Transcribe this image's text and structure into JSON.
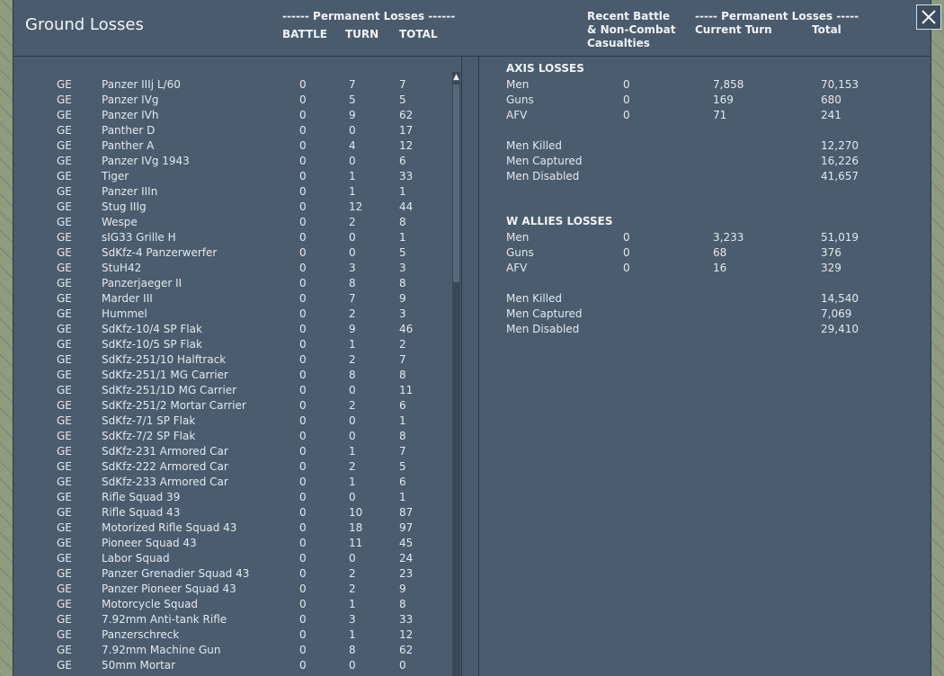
{
  "window": {
    "title": "Ground Losses",
    "left_header": {
      "group": "------ Permanent Losses ------",
      "battle": "BATTLE",
      "turn": "TURN",
      "total": "TOTAL"
    },
    "right_header": {
      "recent_line1": "Recent Battle",
      "recent_line2": "& Non-Combat",
      "recent_line3": "Casualties",
      "group": "----- Permanent Losses -----",
      "current_turn": "Current Turn",
      "total": "Total"
    }
  },
  "units": [
    {
      "nat": "GE",
      "name": "Panzer IIIj L/60",
      "battle": "0",
      "turn": "7",
      "total": "7"
    },
    {
      "nat": "GE",
      "name": "Panzer IVg",
      "battle": "0",
      "turn": "5",
      "total": "5"
    },
    {
      "nat": "GE",
      "name": "Panzer IVh",
      "battle": "0",
      "turn": "9",
      "total": "62"
    },
    {
      "nat": "GE",
      "name": "Panther D",
      "battle": "0",
      "turn": "0",
      "total": "17"
    },
    {
      "nat": "GE",
      "name": "Panther A",
      "battle": "0",
      "turn": "4",
      "total": "12"
    },
    {
      "nat": "GE",
      "name": "Panzer IVg 1943",
      "battle": "0",
      "turn": "0",
      "total": "6"
    },
    {
      "nat": "GE",
      "name": "Tiger",
      "battle": "0",
      "turn": "1",
      "total": "33"
    },
    {
      "nat": "GE",
      "name": "Panzer IIIn",
      "battle": "0",
      "turn": "1",
      "total": "1"
    },
    {
      "nat": "GE",
      "name": "Stug IIIg",
      "battle": "0",
      "turn": "12",
      "total": "44"
    },
    {
      "nat": "GE",
      "name": "Wespe",
      "battle": "0",
      "turn": "2",
      "total": "8"
    },
    {
      "nat": "GE",
      "name": "sIG33 Grille H",
      "battle": "0",
      "turn": "0",
      "total": "1"
    },
    {
      "nat": "GE",
      "name": "SdKfz-4 Panzerwerfer",
      "battle": "0",
      "turn": "0",
      "total": "5"
    },
    {
      "nat": "GE",
      "name": "StuH42",
      "battle": "0",
      "turn": "3",
      "total": "3"
    },
    {
      "nat": "GE",
      "name": "Panzerjaeger II",
      "battle": "0",
      "turn": "8",
      "total": "8"
    },
    {
      "nat": "GE",
      "name": "Marder III",
      "battle": "0",
      "turn": "7",
      "total": "9"
    },
    {
      "nat": "GE",
      "name": "Hummel",
      "battle": "0",
      "turn": "2",
      "total": "3"
    },
    {
      "nat": "GE",
      "name": "SdKfz-10/4 SP Flak",
      "battle": "0",
      "turn": "9",
      "total": "46"
    },
    {
      "nat": "GE",
      "name": "SdKfz-10/5 SP Flak",
      "battle": "0",
      "turn": "1",
      "total": "2"
    },
    {
      "nat": "GE",
      "name": "SdKfz-251/10 Halftrack",
      "battle": "0",
      "turn": "2",
      "total": "7"
    },
    {
      "nat": "GE",
      "name": "SdKfz-251/1 MG Carrier",
      "battle": "0",
      "turn": "8",
      "total": "8"
    },
    {
      "nat": "GE",
      "name": "SdKfz-251/1D MG Carrier",
      "battle": "0",
      "turn": "0",
      "total": "11"
    },
    {
      "nat": "GE",
      "name": "SdKfz-251/2 Mortar Carrier",
      "battle": "0",
      "turn": "2",
      "total": "6"
    },
    {
      "nat": "GE",
      "name": "SdKfz-7/1 SP Flak",
      "battle": "0",
      "turn": "0",
      "total": "1"
    },
    {
      "nat": "GE",
      "name": "SdKfz-7/2 SP Flak",
      "battle": "0",
      "turn": "0",
      "total": "8"
    },
    {
      "nat": "GE",
      "name": "SdKfz-231 Armored Car",
      "battle": "0",
      "turn": "1",
      "total": "7"
    },
    {
      "nat": "GE",
      "name": "SdKfz-222 Armored Car",
      "battle": "0",
      "turn": "2",
      "total": "5"
    },
    {
      "nat": "GE",
      "name": "SdKfz-233 Armored Car",
      "battle": "0",
      "turn": "1",
      "total": "6"
    },
    {
      "nat": "GE",
      "name": "Rifle Squad 39",
      "battle": "0",
      "turn": "0",
      "total": "1"
    },
    {
      "nat": "GE",
      "name": "Rifle Squad 43",
      "battle": "0",
      "turn": "10",
      "total": "87"
    },
    {
      "nat": "GE",
      "name": "Motorized Rifle Squad 43",
      "battle": "0",
      "turn": "18",
      "total": "97"
    },
    {
      "nat": "GE",
      "name": "Pioneer Squad 43",
      "battle": "0",
      "turn": "11",
      "total": "45"
    },
    {
      "nat": "GE",
      "name": "Labor Squad",
      "battle": "0",
      "turn": "0",
      "total": "24"
    },
    {
      "nat": "GE",
      "name": "Panzer Grenadier Squad 43",
      "battle": "0",
      "turn": "2",
      "total": "23"
    },
    {
      "nat": "GE",
      "name": "Panzer Pioneer Squad 43",
      "battle": "0",
      "turn": "2",
      "total": "9"
    },
    {
      "nat": "GE",
      "name": "Motorcycle Squad",
      "battle": "0",
      "turn": "1",
      "total": "8"
    },
    {
      "nat": "GE",
      "name": "7.92mm Anti-tank Rifle",
      "battle": "0",
      "turn": "3",
      "total": "33"
    },
    {
      "nat": "GE",
      "name": "Panzerschreck",
      "battle": "0",
      "turn": "1",
      "total": "12"
    },
    {
      "nat": "GE",
      "name": "7.92mm Machine Gun",
      "battle": "0",
      "turn": "8",
      "total": "62"
    },
    {
      "nat": "GE",
      "name": "50mm Mortar",
      "battle": "0",
      "turn": "0",
      "total": "0"
    }
  ],
  "axis": {
    "title": "AXIS LOSSES",
    "rows": [
      {
        "label": "Men",
        "recent": "0",
        "current": "7,858",
        "total": "70,153"
      },
      {
        "label": "Guns",
        "recent": "0",
        "current": "169",
        "total": "680"
      },
      {
        "label": "AFV",
        "recent": "0",
        "current": "71",
        "total": "241"
      }
    ],
    "detail": [
      {
        "label": "Men Killed",
        "total": "12,270"
      },
      {
        "label": "Men Captured",
        "total": "16,226"
      },
      {
        "label": "Men Disabled",
        "total": "41,657"
      }
    ]
  },
  "allies": {
    "title": "W ALLIES LOSSES",
    "rows": [
      {
        "label": "Men",
        "recent": "0",
        "current": "3,233",
        "total": "51,019"
      },
      {
        "label": "Guns",
        "recent": "0",
        "current": "68",
        "total": "376"
      },
      {
        "label": "AFV",
        "recent": "0",
        "current": "16",
        "total": "329"
      }
    ],
    "detail": [
      {
        "label": "Men Killed",
        "total": "14,540"
      },
      {
        "label": "Men Captured",
        "total": "7,069"
      },
      {
        "label": "Men Disabled",
        "total": "29,410"
      }
    ]
  },
  "icons": {
    "close": "close-icon",
    "scroll_up": "scroll-up-arrow-icon"
  }
}
